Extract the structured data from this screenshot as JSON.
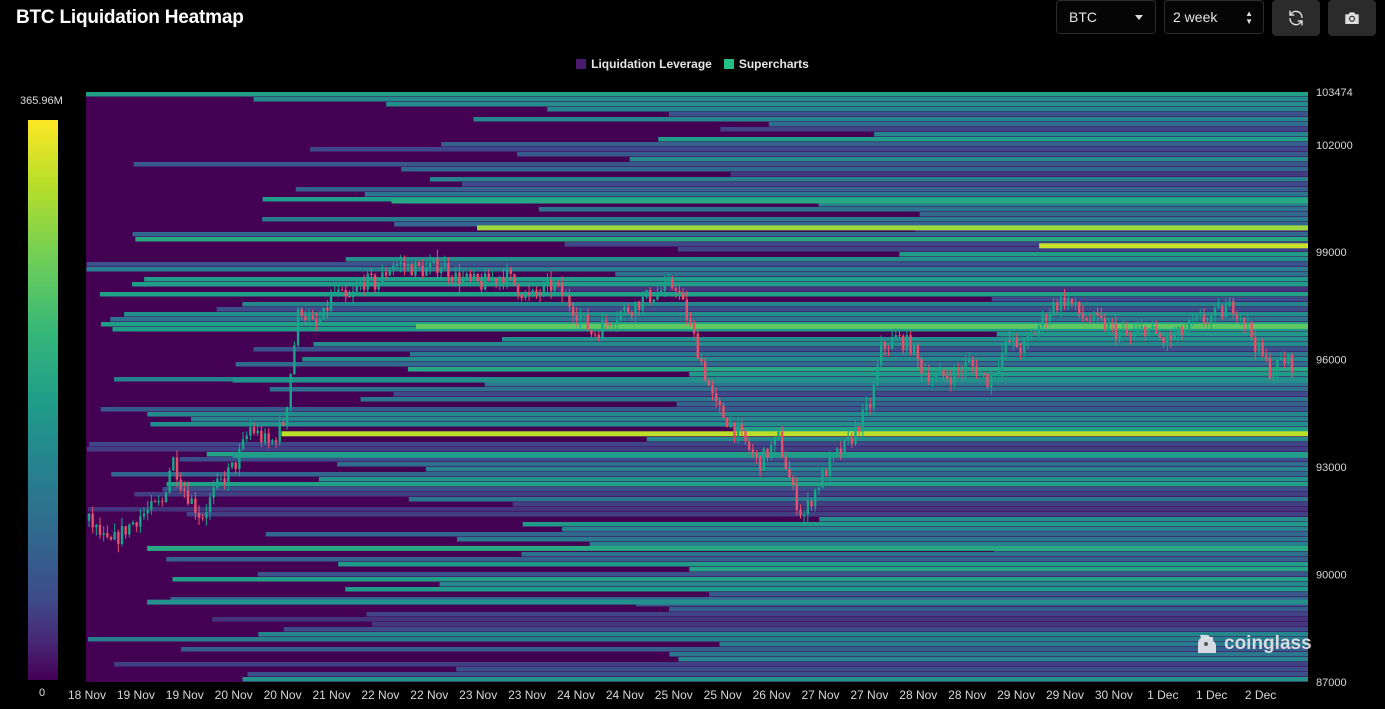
{
  "header": {
    "title": "BTC Liquidation Heatmap"
  },
  "controls": {
    "symbol": "BTC",
    "range": "2 week",
    "refresh_icon": "refresh-icon",
    "screenshot_icon": "camera-icon"
  },
  "legend": [
    {
      "label": "Liquidation Leverage",
      "color": "#4a1c6e"
    },
    {
      "label": "Supercharts",
      "color": "#22c083"
    }
  ],
  "colorbar": {
    "max_label": "365.96M",
    "min_label": "0"
  },
  "watermark": "coinglass",
  "chart_data": {
    "type": "heatmap",
    "title": "BTC Liquidation Heatmap",
    "x_tick_labels": [
      "18 Nov",
      "19 Nov",
      "19 Nov",
      "20 Nov",
      "20 Nov",
      "21 Nov",
      "22 Nov",
      "22 Nov",
      "23 Nov",
      "23 Nov",
      "24 Nov",
      "24 Nov",
      "25 Nov",
      "25 Nov",
      "26 Nov",
      "27 Nov",
      "27 Nov",
      "28 Nov",
      "28 Nov",
      "29 Nov",
      "29 Nov",
      "30 Nov",
      "1 Dec",
      "1 Dec",
      "2 Dec"
    ],
    "y_ticks": [
      103474,
      102000,
      99000,
      96000,
      93000,
      90000,
      87000
    ],
    "y_tick_labels": [
      "103474",
      "102000",
      "99000",
      "96000",
      "93000",
      "90000",
      "87000"
    ],
    "ylim": [
      87000,
      103474
    ],
    "colorscale": {
      "min": 0,
      "max": 365.96,
      "unit": "M"
    },
    "colors": {
      "low": "#440154",
      "mid": "#21918c",
      "high": "#fde725",
      "candle_up": "#17a589",
      "candle_down": "#e84f6b"
    },
    "price_path": [
      [
        0,
        91500
      ],
      [
        0.4,
        90800
      ],
      [
        1,
        91600
      ],
      [
        1.5,
        92000
      ],
      [
        1.7,
        93300
      ],
      [
        1.9,
        92500
      ],
      [
        2.3,
        91600
      ],
      [
        2.6,
        92400
      ],
      [
        3,
        93100
      ],
      [
        3.3,
        94100
      ],
      [
        3.7,
        93600
      ],
      [
        4,
        94300
      ],
      [
        4.1,
        95400
      ],
      [
        4.3,
        97500
      ],
      [
        4.6,
        96900
      ],
      [
        4.8,
        97200
      ],
      [
        5,
        97900
      ],
      [
        5.3,
        97600
      ],
      [
        5.6,
        98200
      ],
      [
        5.9,
        98100
      ],
      [
        6.2,
        98700
      ],
      [
        6.5,
        98600
      ],
      [
        6.9,
        98500
      ],
      [
        7.2,
        98700
      ],
      [
        7.5,
        98300
      ],
      [
        8,
        98100
      ],
      [
        8.5,
        98400
      ],
      [
        9,
        97700
      ],
      [
        9.5,
        98100
      ],
      [
        10,
        97300
      ],
      [
        10.3,
        96700
      ],
      [
        10.7,
        97200
      ],
      [
        11,
        97400
      ],
      [
        11.5,
        97800
      ],
      [
        12,
        98100
      ],
      [
        12.4,
        96500
      ],
      [
        12.8,
        94700
      ],
      [
        13.2,
        94100
      ],
      [
        13.7,
        93100
      ],
      [
        14.1,
        93800
      ],
      [
        14.4,
        92300
      ],
      [
        14.6,
        91600
      ],
      [
        14.9,
        92500
      ],
      [
        15.2,
        93200
      ],
      [
        15.5,
        93600
      ],
      [
        16,
        94800
      ],
      [
        16.2,
        96300
      ],
      [
        16.5,
        96600
      ],
      [
        16.8,
        96400
      ],
      [
        17,
        95800
      ],
      [
        17.3,
        95500
      ],
      [
        17.7,
        95600
      ],
      [
        18,
        95900
      ],
      [
        18.4,
        95400
      ],
      [
        18.8,
        96500
      ],
      [
        19.1,
        96300
      ],
      [
        19.4,
        96900
      ],
      [
        19.7,
        97500
      ],
      [
        20,
        97700
      ],
      [
        20.3,
        97200
      ],
      [
        20.7,
        97000
      ],
      [
        21,
        96800
      ],
      [
        21.3,
        96600
      ],
      [
        21.6,
        96900
      ],
      [
        22,
        96500
      ],
      [
        22.3,
        96700
      ],
      [
        22.6,
        97000
      ],
      [
        23,
        97200
      ],
      [
        23.4,
        97500
      ],
      [
        23.6,
        97200
      ],
      [
        23.9,
        96300
      ],
      [
        24.2,
        95600
      ],
      [
        24.4,
        96000
      ],
      [
        24.6,
        95900
      ]
    ]
  }
}
